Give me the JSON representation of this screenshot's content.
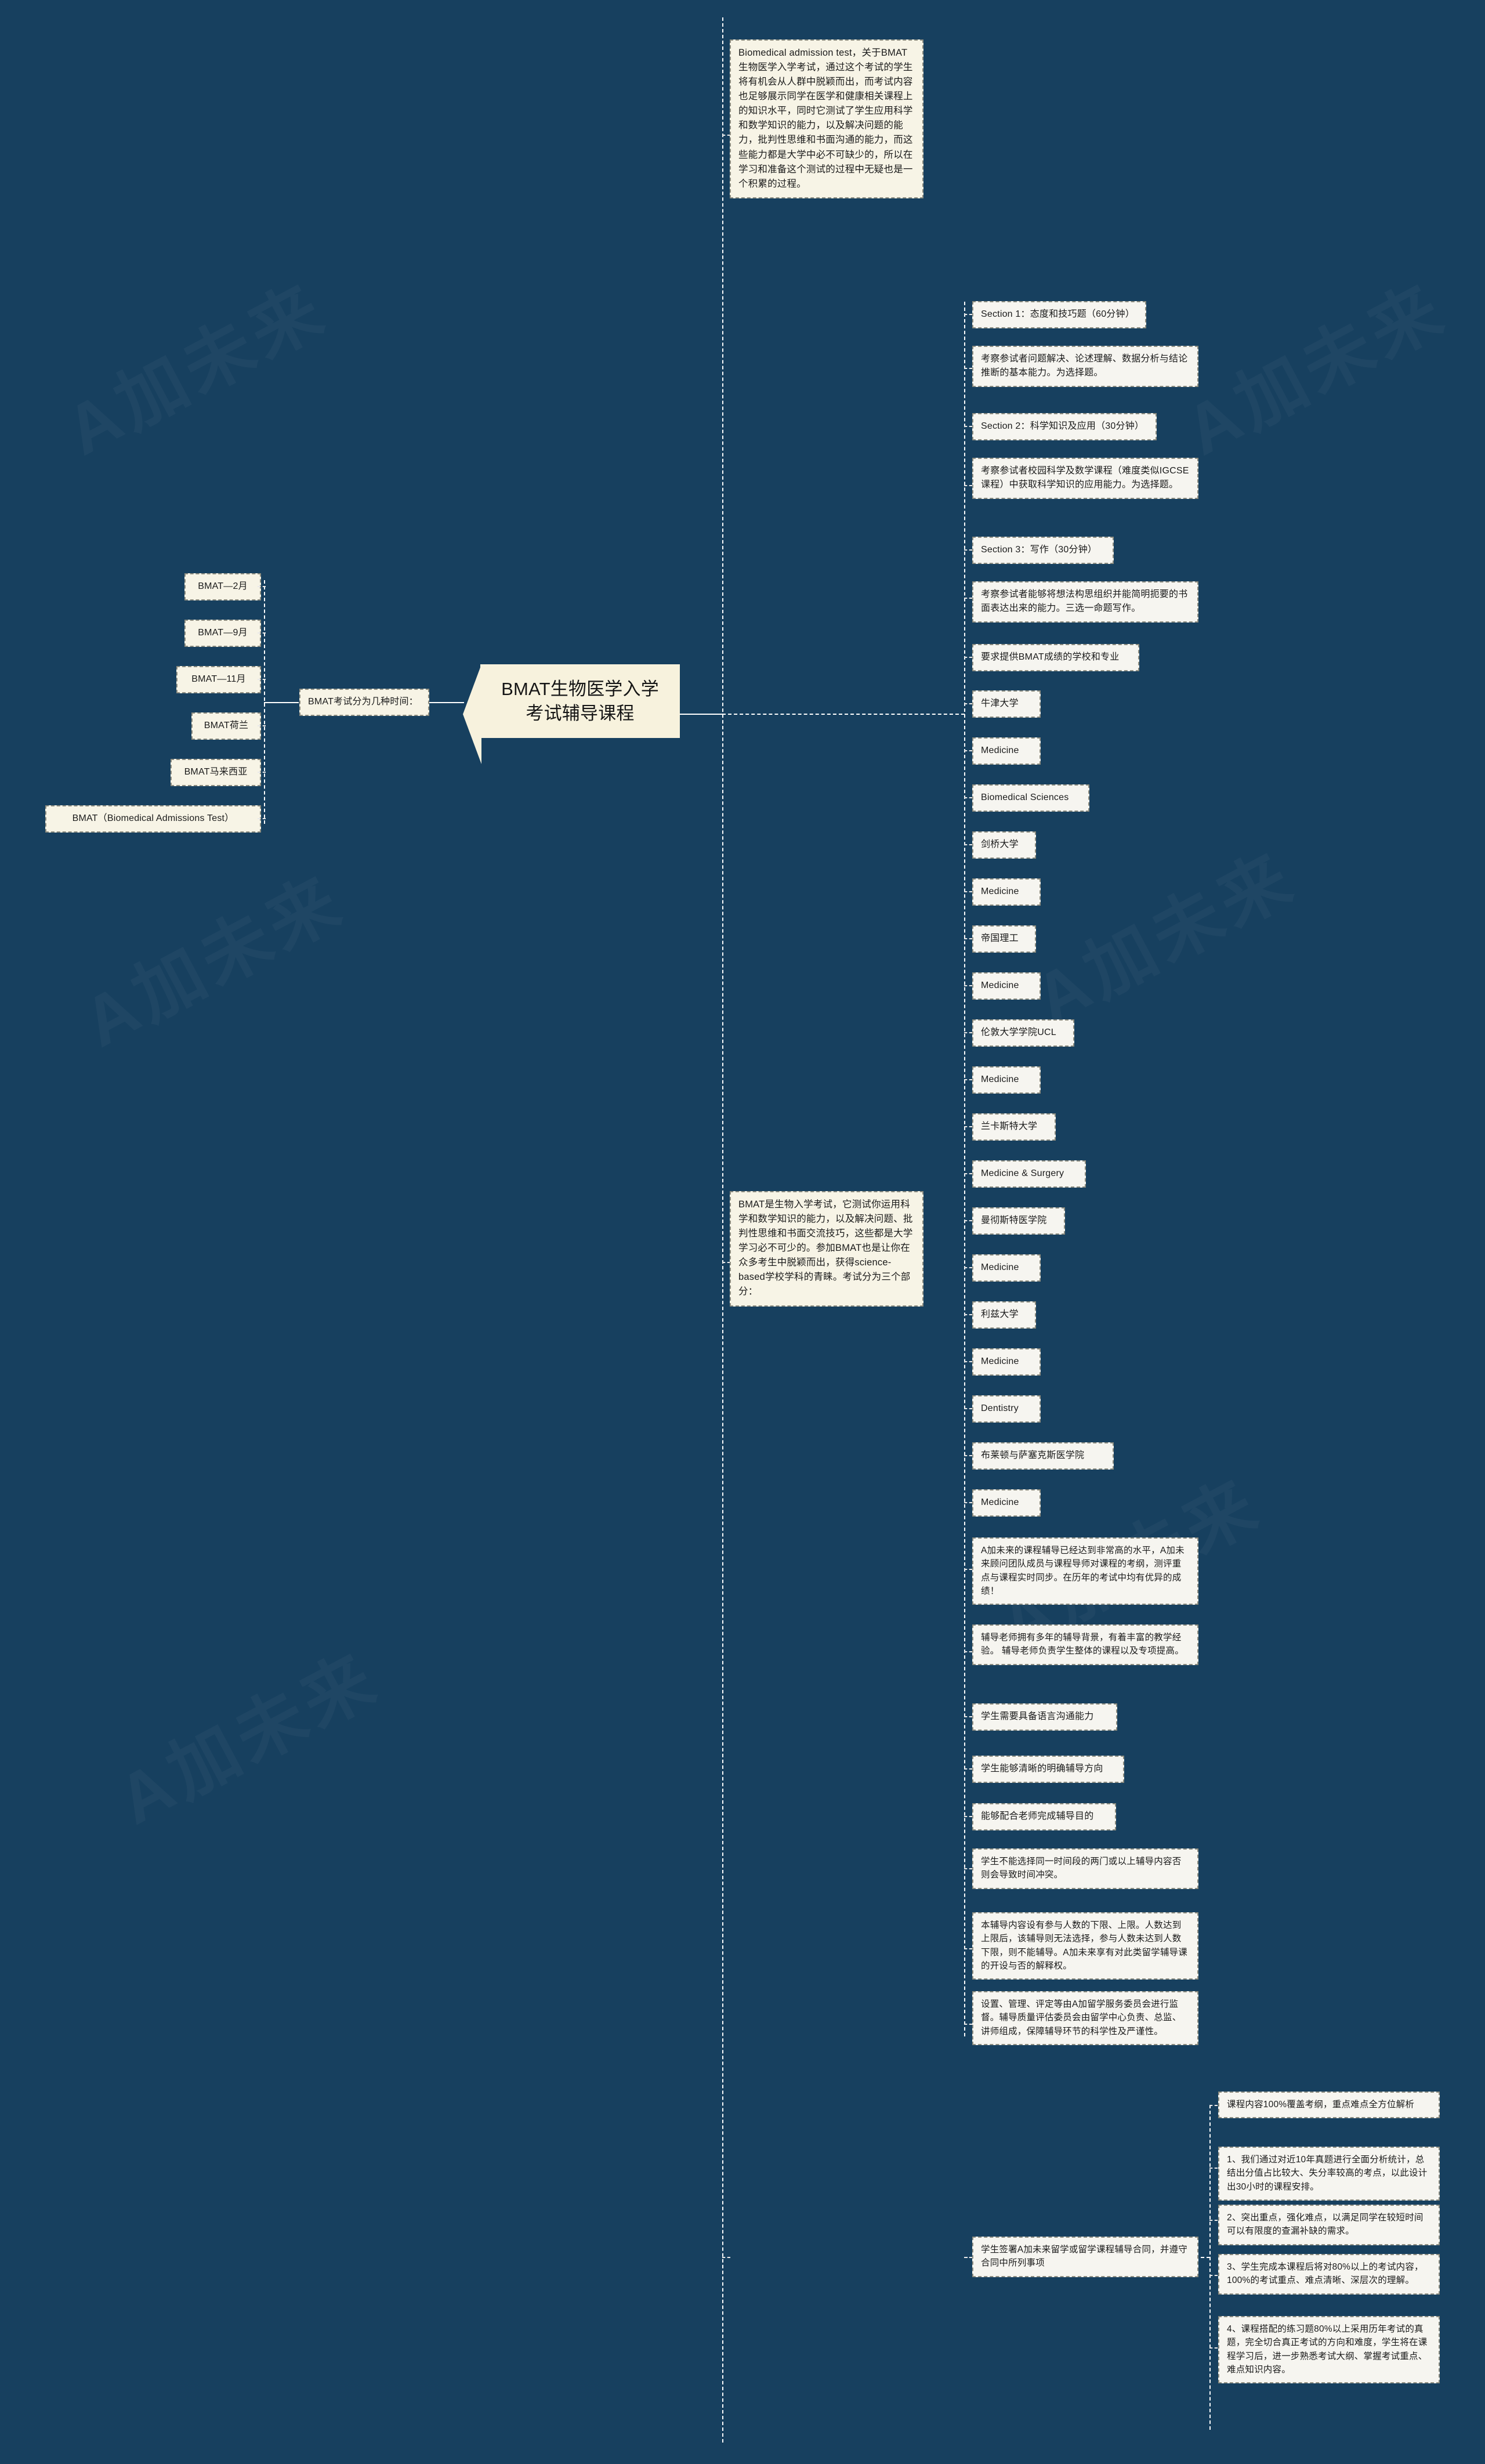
{
  "theme": {
    "background": "#17405f",
    "node_fill": "#f7f4e6",
    "node_fill_plain": "#f6f5f0",
    "center_fill": "#f7f2dd",
    "connector": "#ffffff",
    "text": "#1a1a1a"
  },
  "center": {
    "title": "BMAT生物医学入学考试辅导课程"
  },
  "intro": {
    "text": "Biomedical admission test，关于BMAT生物医学入学考试，通过这个考试的学生将有机会从人群中脱颖而出，而考试内容也足够展示同学在医学和健康相关课程上的知识水平，同时它测试了学生应用科学和数学知识的能力，以及解决问题的能力，批判性思维和书面沟通的能力，而这些能力都是大学中必不可缺少的，所以在学习和准备这个测试的过程中无疑也是一个积累的过程。"
  },
  "exam_times": {
    "label": "BMAT考试分为几种时间：",
    "items": [
      "BMAT—2月",
      "BMAT—9月",
      "BMAT—11月",
      "BMAT荷兰",
      "BMAT马来西亚",
      "BMAT（Biomedical Admissions Test）"
    ]
  },
  "description": {
    "text": "BMAT是生物入学考试，它测试你运用科学和数学知识的能力，以及解决问题、批判性思维和书面交流技巧，这些都是大学学习必不可少的。参加BMAT也是让你在众多考生中脱颖而出，获得science-based学校学科的青睐。考试分为三个部分："
  },
  "sections": [
    {
      "title": "Section 1：态度和技巧题（60分钟）",
      "detail": "考察参试者问题解决、论述理解、数据分析与结论推断的基本能力。为选择题。"
    },
    {
      "title": "Section 2：科学知识及应用（30分钟）",
      "detail": "考察参试者校园科学及数学课程（难度类似IGCSE课程）中获取科学知识的应用能力。为选择题。"
    },
    {
      "title": "Section 3：写作（30分钟）",
      "detail": "考察参试者能够将想法构思组织并能简明扼要的书面表达出来的能力。三选一命题写作。"
    }
  ],
  "schools": {
    "heading": "要求提供BMAT成绩的学校和专业",
    "items": [
      {
        "name": "牛津大学",
        "subjects": [
          "Medicine",
          "Biomedical Sciences"
        ]
      },
      {
        "name": "剑桥大学",
        "subjects": [
          "Medicine"
        ]
      },
      {
        "name": "帝国理工",
        "subjects": [
          "Medicine"
        ]
      },
      {
        "name": "伦敦大学学院UCL",
        "subjects": [
          "Medicine"
        ]
      },
      {
        "name": "兰卡斯特大学",
        "subjects": [
          "Medicine & Surgery"
        ]
      },
      {
        "name": "曼彻斯特医学院",
        "subjects": [
          "Medicine"
        ]
      },
      {
        "name": "利兹大学",
        "subjects": [
          "Medicine",
          "Dentistry"
        ]
      },
      {
        "name": "布莱顿与萨塞克斯医学院",
        "subjects": [
          "Medicine"
        ]
      }
    ]
  },
  "tutoring": {
    "items": [
      "A加未来的课程辅导已经达到非常高的水平，A加未来顾问团队成员与课程导师对课程的考纲，测评重点与课程实时同步。在历年的考试中均有优异的成绩！",
      "辅导老师拥有多年的辅导背景，有着丰富的教学经验。 辅导老师负责学生整体的课程以及专项提高。",
      "学生需要具备语言沟通能力",
      "学生能够清晰的明确辅导方向",
      "能够配合老师完成辅导目的",
      "学生不能选择同一时间段的两门或以上辅导内容否则会导致时间冲突。",
      "本辅导内容设有参与人数的下限、上限。人数达到上限后，该辅导则无法选择，参与人数未达到人数下限，则不能辅导。A加未来享有对此类留学辅导课的开设与否的解释权。",
      "设置、管理、评定等由A加留学服务委员会进行监督。辅导质量评估委员会由留学中心负责、总监、讲师组成，保障辅导环节的科学性及严谨性。"
    ]
  },
  "contract": {
    "text": "学生签署A加未来留学或留学课程辅导合同，并遵守合同中所列事项"
  },
  "course_content": {
    "heading": "课程内容100%覆盖考纲，重点难点全方位解析",
    "points": [
      "1、我们通过对近10年真题进行全面分析统计，总结出分值占比较大、失分率较高的考点，以此设计出30小时的课程安排。",
      "2、突出重点，强化难点，以满足同学在较短时间可以有限度的查漏补缺的需求。",
      "3、学生完成本课程后将对80%以上的考试内容，100%的考试重点、难点清晰、深层次的理解。",
      "4、课程搭配的练习题80%以上采用历年考试的真题，完全切合真正考试的方向和难度，学生将在课程学习后，进一步熟悉考试大纲、掌握考试重点、难点知识内容。"
    ]
  },
  "watermarks": [
    "A加未来",
    "A加未来",
    "A加未来",
    "A加未来",
    "A加未来",
    "A加未来"
  ]
}
